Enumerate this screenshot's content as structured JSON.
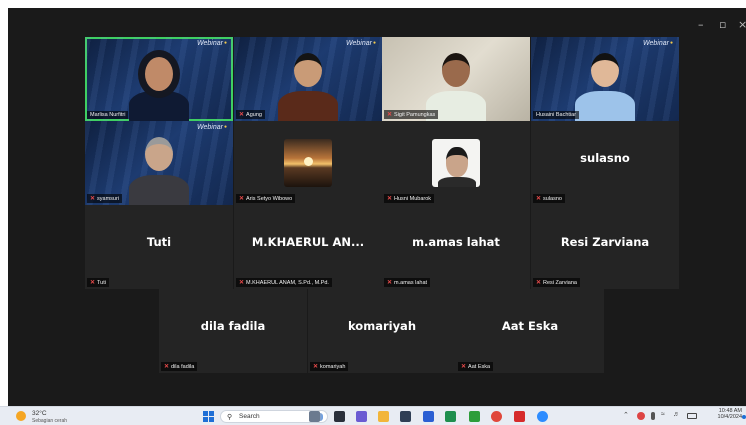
{
  "window": {
    "controls": {
      "minimize": "–",
      "maximize": "▫",
      "close": "×"
    }
  },
  "gallery": {
    "brand_label": "Webinar",
    "tiles": [
      {
        "name": "Marlisa Nurfitri",
        "muted": false,
        "type": "video",
        "active": true
      },
      {
        "name": "Agung",
        "muted": true,
        "type": "video"
      },
      {
        "name": "Sigit Pamungkas",
        "muted": true,
        "type": "video"
      },
      {
        "name": "Husaini Bachtiar",
        "muted": false,
        "type": "video"
      },
      {
        "name": "syamsuri",
        "muted": true,
        "type": "video"
      },
      {
        "name": "Aris Setyo Wibowo",
        "muted": true,
        "type": "photo",
        "photo": "sunset"
      },
      {
        "name": "Husni Mubarok",
        "muted": true,
        "type": "photo",
        "photo": "portrait"
      },
      {
        "name": "sulasno",
        "display": "sulasno",
        "muted": true,
        "type": "name"
      },
      {
        "name": "Tuti",
        "display": "Tuti",
        "muted": true,
        "type": "name"
      },
      {
        "name": "M.KHAERUL ANAM, S.Pd., M.Pd.",
        "display": "M.KHAERUL  AN...",
        "muted": true,
        "type": "name"
      },
      {
        "name": "m.amas lahat",
        "display": "m.amas lahat",
        "muted": true,
        "type": "name"
      },
      {
        "name": "Resi Zarviana",
        "display": "Resi Zarviana",
        "muted": true,
        "type": "name"
      },
      {
        "name": "dila fadila",
        "display": "dila fadila",
        "muted": true,
        "type": "name"
      },
      {
        "name": "komariyah",
        "display": "komariyah",
        "muted": true,
        "type": "name"
      },
      {
        "name": "Aat Eska",
        "display": "Aat Eska",
        "muted": true,
        "type": "name"
      }
    ]
  },
  "taskbar": {
    "weather_temp": "32°C",
    "weather_desc": "Sebagian cerah",
    "search_placeholder": "Search",
    "time": "10:48 AM",
    "date": "10/4/2024",
    "apps": [
      "file-explorer",
      "store",
      "teams",
      "folder",
      "explorer",
      "word",
      "excel",
      "xbox",
      "chrome",
      "acrobat",
      "zoom"
    ],
    "colors": {
      "accent": "#3fcf63",
      "tile_bg": "#242424",
      "window_bg": "#1a1a1a"
    }
  }
}
